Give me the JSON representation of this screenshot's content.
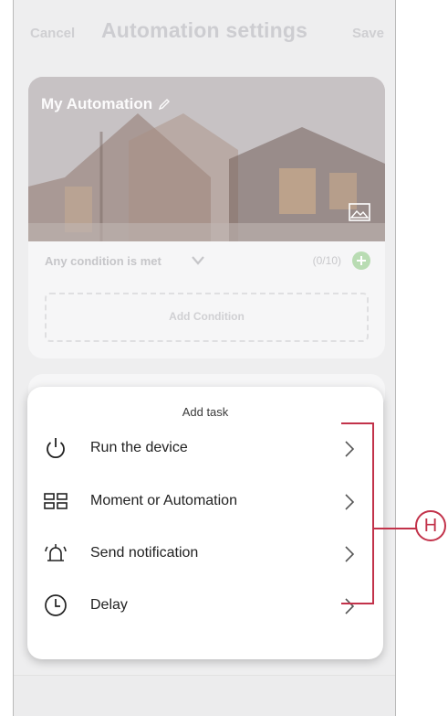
{
  "header": {
    "cancel_label": "Cancel",
    "title": "Automation settings",
    "save_label": "Save"
  },
  "automation": {
    "name": "My Automation",
    "edit_icon": "pencil-icon",
    "image_icon": "image-icon"
  },
  "conditions": {
    "match_label": "Any condition is met",
    "count": "(0/10)",
    "add_condition_label": "Add Condition",
    "add_icon": "plus-circle-icon"
  },
  "add_task_sheet": {
    "title": "Add task",
    "items": [
      {
        "label": "Run the device",
        "icon": "power-icon"
      },
      {
        "label": "Moment or Automation",
        "icon": "grid-icon"
      },
      {
        "label": "Send notification",
        "icon": "alarm-bell-icon"
      },
      {
        "label": "Delay",
        "icon": "clock-icon"
      }
    ]
  },
  "annotation": {
    "callout_label": "H",
    "color": "#c2324a"
  },
  "colors": {
    "accent_green": "#4caf50"
  }
}
